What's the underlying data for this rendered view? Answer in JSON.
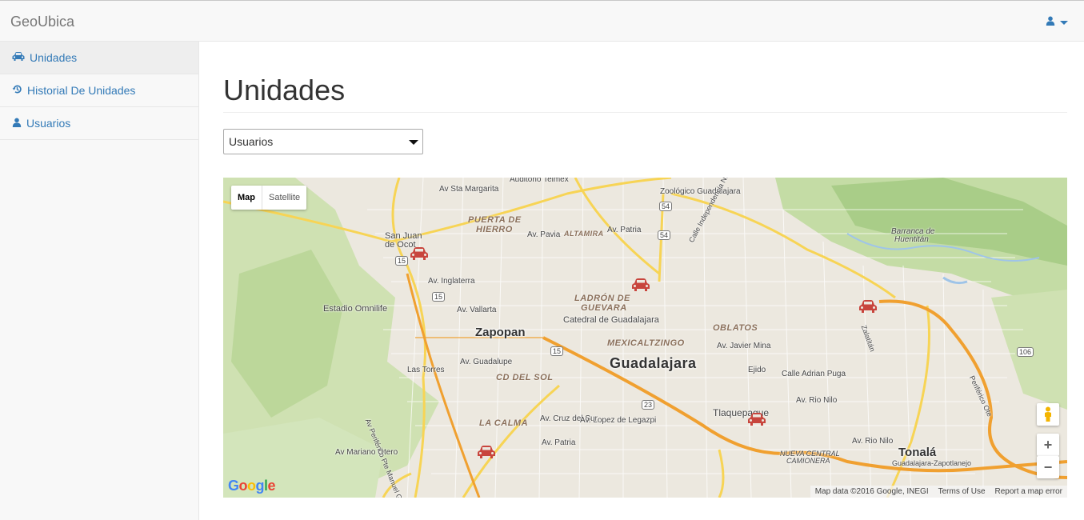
{
  "navbar": {
    "brand": "GeoUbica",
    "user_icon": "user-icon"
  },
  "sidebar": {
    "items": [
      {
        "label": "Unidades",
        "icon": "car-icon",
        "active": true
      },
      {
        "label": "Historial De Unidades",
        "icon": "history-icon",
        "active": false
      },
      {
        "label": "Usuarios",
        "icon": "user-icon",
        "active": false
      }
    ]
  },
  "main": {
    "title": "Unidades",
    "select": {
      "value": "Usuarios"
    }
  },
  "map": {
    "type_map": "Map",
    "type_satellite": "Satellite",
    "zoom_in": "+",
    "zoom_out": "−",
    "logo": "Google",
    "attribution": "Map data ©2016 Google, INEGI",
    "terms": "Terms of Use",
    "report": "Report a map error",
    "labels": {
      "auditorio": "Auditorio Telmex",
      "sta_margarita": "Av Sta Margarita",
      "zoologico": "Zoológico Guadalajara",
      "puerta_line1": "PUERTA DE",
      "puerta_line2": "HIERRO",
      "altamira": "ALTAMIRA",
      "av_patria": "Av. Patria",
      "av_pavia": "Av. Pavia",
      "barranca_line1": "Barranca de",
      "barranca_line2": "Huentitán",
      "san_juan_line1": "San Juan",
      "san_juan_line2": "de Ocot",
      "av_inglaterra": "Av. Inglaterra",
      "ladron_line1": "LADRÓN DE",
      "ladron_line2": "GUEVARA",
      "estadio": "Estadio Omnilife",
      "av_vallarta": "Av. Vallarta",
      "catedral": "Catedral de Guadalajara",
      "oblatos": "OBLATOS",
      "zapopan": "Zapopan",
      "mexicaltzingo": "MEXICALTZINGO",
      "javier_mina": "Av. Javier Mina",
      "guadalajara": "Guadalajara",
      "av_guadalupe": "Av. Guadalupe",
      "cd_del_sol": "CD DEL SOL",
      "adrian_puga": "Calle Adrian Puga",
      "las_torres": "Las Torres",
      "av_rio_nilo": "Av. Rio Nilo",
      "tlaquepaque": "Tlaquepaque",
      "la_calma": "LA CALMA",
      "av_cruz_del_sur": "Av. Cruz del Sur",
      "lopez_legazpi": "Av. Lopez de Legazpi",
      "av_patria_s": "Av. Patria",
      "nueva_central_line1": "NUEVA CENTRAL",
      "nueva_central_line2": "CAMIONERA",
      "tonala": "Tonalá",
      "mariano_otero": "Av Mariano Otero",
      "periferico_pte": "Av Periférico Pte Manuel Gómez Morin",
      "periferico_ote": "Periférico Ote",
      "gdl_zapotlanejo": "Guadalajara-Zapotlanejo",
      "calle_independencia": "Calle Independencia Nte",
      "zalatitan": "Zalatitán",
      "av_rio_nilo_2": "Av. Rio Nilo",
      "ejido": "Ejido"
    },
    "shields": [
      "54",
      "54",
      "15",
      "15",
      "15",
      "23",
      "106"
    ],
    "colors": {
      "highway": "#f0a030",
      "arterial": "#f7d455",
      "park": "#c8dfa8",
      "water": "#9fc4e8",
      "car": "#c8453d"
    }
  }
}
